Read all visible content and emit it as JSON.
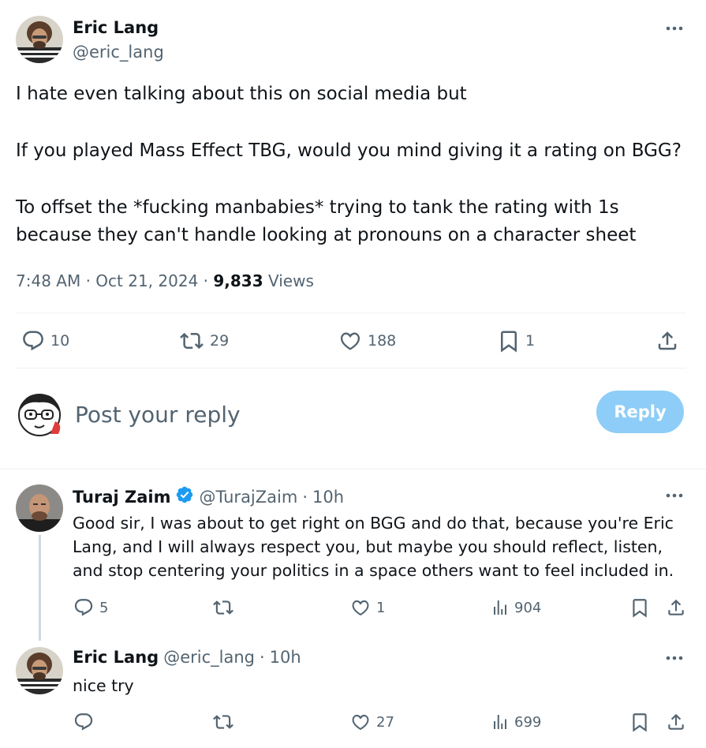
{
  "main_tweet": {
    "author_name": "Eric Lang",
    "author_handle": "@eric_lang",
    "paragraphs": [
      "I hate even talking about this on social media but",
      "If you played Mass Effect TBG, would you mind giving it a rating on BGG?",
      "To offset the *fucking manbabies* trying to tank the rating with 1s because they can't handle looking at pronouns on a character sheet"
    ],
    "time": "7:48 AM",
    "date": "Oct 21, 2024",
    "views_count": "9,833",
    "views_label": "Views",
    "separator": "·",
    "stats": {
      "replies": "10",
      "reposts": "29",
      "likes": "188",
      "bookmarks": "1"
    }
  },
  "composer": {
    "placeholder": "Post your reply",
    "button_label": "Reply"
  },
  "replies": [
    {
      "author_name": "Turaj Zaim",
      "author_handle": "@TurajZaim",
      "verified": true,
      "time_ago": "10h",
      "text": "Good sir, I was about to get right on BGG and do that, because you're Eric Lang, and I will always respect you, but maybe you should reflect, listen, and stop centering your politics in a space others want to feel included in.",
      "stats": {
        "replies": "5",
        "reposts": "",
        "likes": "1",
        "views": "904"
      }
    },
    {
      "author_name": "Eric Lang",
      "author_handle": "@eric_lang",
      "verified": false,
      "time_ago": "10h",
      "text": "nice try",
      "stats": {
        "replies": "",
        "reposts": "",
        "likes": "27",
        "views": "699"
      }
    }
  ],
  "colors": {
    "text": "#0f1419",
    "muted": "#536471",
    "reply_button_disabled": "#8ecdf7",
    "verified_blue": "#1d9bf0",
    "divider": "#eff3f4"
  },
  "icons": [
    "more-icon",
    "reply-icon",
    "repost-icon",
    "like-icon",
    "bookmark-icon",
    "share-icon",
    "views-icon",
    "verified-icon"
  ]
}
